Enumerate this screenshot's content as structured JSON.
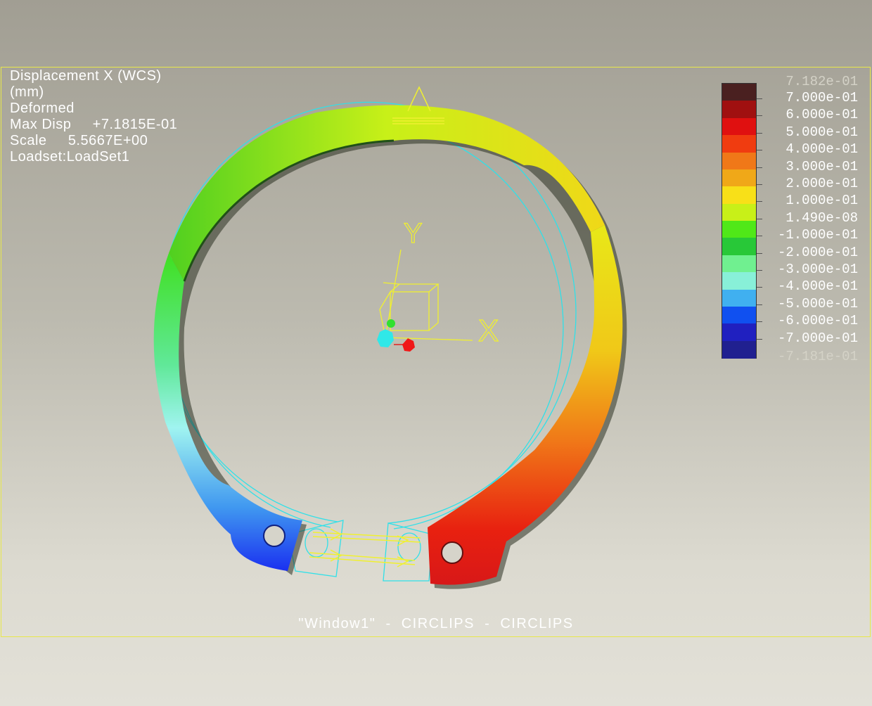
{
  "info": {
    "lines": [
      "Displacement X (WCS)",
      "(mm)",
      "Deformed",
      "Max Disp     +7.1815E-01",
      "Scale     5.5667E+00",
      "Loadset:LoadSet1"
    ]
  },
  "window_label": "\"Window1\"  -  CIRCLIPS  -  CIRCLIPS",
  "axes": {
    "x_label": "X",
    "y_label": "Y"
  },
  "legend": {
    "max_label": "7.182e-01",
    "min_label": "-7.181e-01",
    "labels": [
      "7.000e-01",
      "6.000e-01",
      "5.000e-01",
      "4.000e-01",
      "3.000e-01",
      "2.000e-01",
      "1.000e-01",
      "1.490e-08",
      "-1.000e-01",
      "-2.000e-01",
      "-3.000e-01",
      "-4.000e-01",
      "-5.000e-01",
      "-6.000e-01",
      "-7.000e-01"
    ],
    "colors": [
      "#4a2020",
      "#a01010",
      "#e01010",
      "#f03c10",
      "#f07818",
      "#f0a818",
      "#f8e018",
      "#c8f018",
      "#50e818",
      "#28c838",
      "#70f090",
      "#88f0d8",
      "#40b0f0",
      "#1050f0",
      "#2020c0",
      "#202090"
    ]
  }
}
